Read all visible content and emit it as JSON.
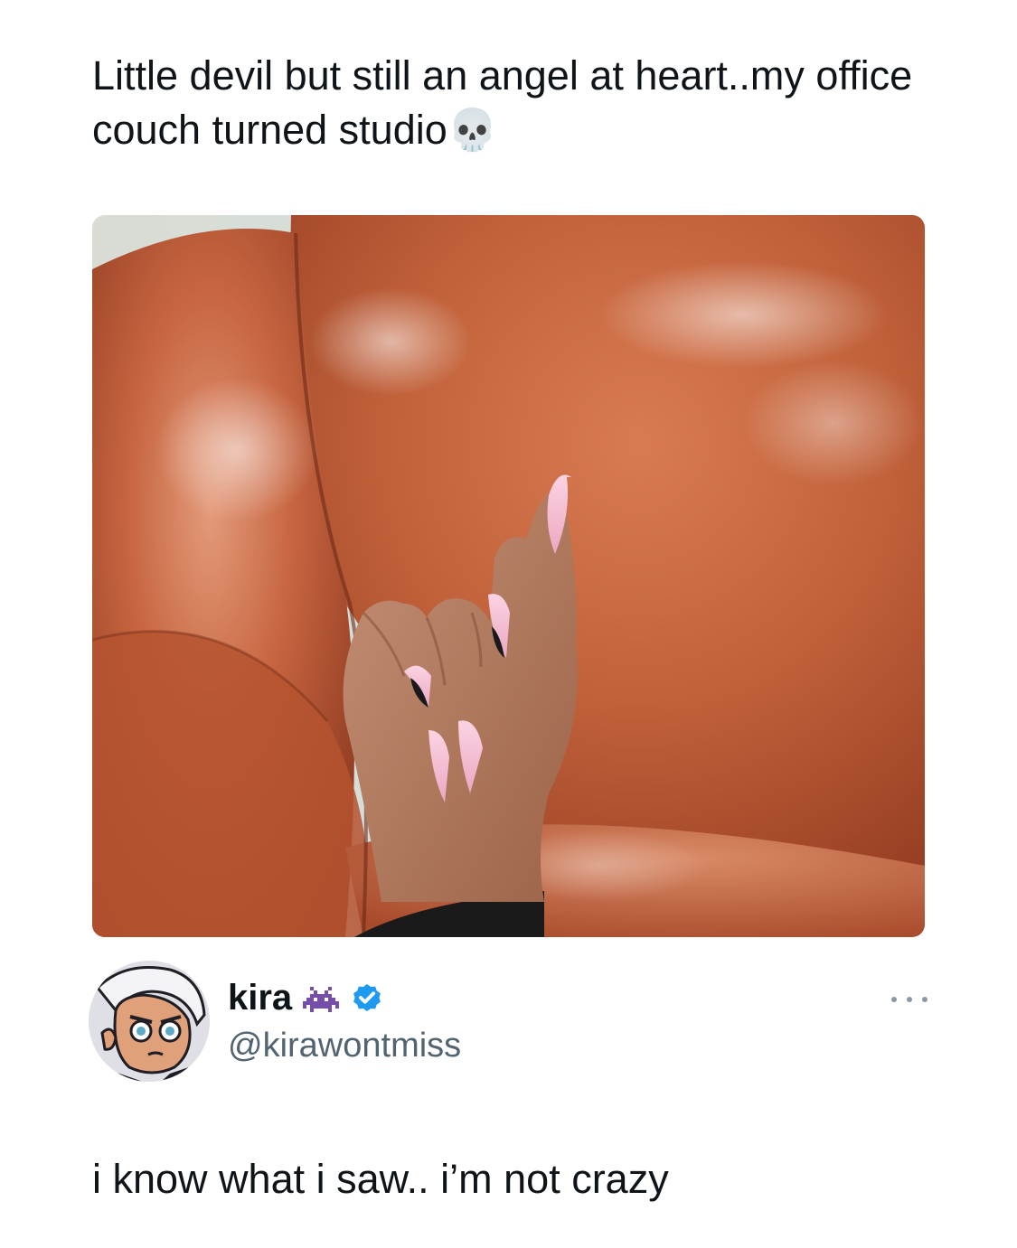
{
  "quoted_post": {
    "text": "Little devil but still an angel at heart..my office couch turned studio💀",
    "image_description_icon": "photo-hand-pink-nails-leather-couch"
  },
  "author": {
    "display_name": "kira",
    "name_emoji": "👾",
    "verified": true,
    "handle": "@kirawontmiss",
    "avatar_icon": "cartoon-avatar"
  },
  "post": {
    "text": "i know what i saw.. i’m not crazy"
  },
  "colors": {
    "text_primary": "#0f1419",
    "text_secondary": "#536471",
    "verified_blue": "#1d9bf0",
    "couch_leather": "#b9572f",
    "nail_pink": "#f3b7cf"
  }
}
